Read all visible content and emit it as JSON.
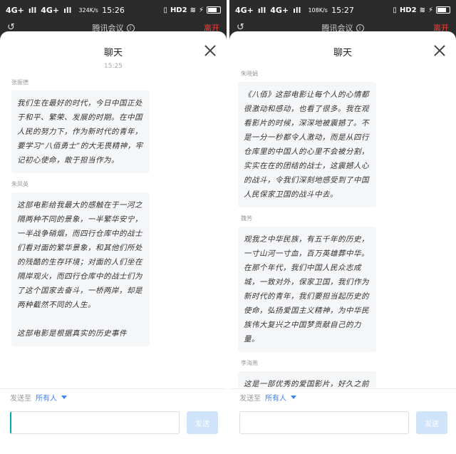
{
  "left": {
    "status": {
      "carrier1": "4G+",
      "carrier2": "4G+",
      "speed": "324K/s",
      "time": "15:26",
      "hd": "HD2"
    },
    "appbar": {
      "title": "腾讯会议",
      "leave": "离开"
    },
    "sheet_title": "聊天",
    "timestamp": "15:25",
    "messages": [
      {
        "sender": "张振德",
        "text": "我们生在最好的时代，今日中国正处于和平、繁荣、发展的时期。在中国人民的努力下，作为新时代的青年，要学习“八佰勇士”的大无畏精神，牢记初心使命，敢于担当作为。"
      },
      {
        "sender": "朱凤英",
        "text": "这部电影给我最大的感触在于一河之隔两种不同的景象，一半繁华安宁，一半战争硝烟，而四行仓库中的战士们看对面的繁华景象，和其他们所处的残酷的生存环境；对面的人们坐在隔岸观火，而四行仓库中的战士们为了这个国家去奋斗，一桥两岸，却是两种截然不同的人生。"
      },
      {
        "sender": "",
        "text": "这部电影是根据真实的历史事件"
      }
    ],
    "footer": {
      "send_to_label": "发送至",
      "send_to_target": "所有人",
      "input_value": "",
      "send_label": "发送"
    }
  },
  "right": {
    "status": {
      "carrier1": "4G+",
      "carrier2": "4G+",
      "speed": "108K/s",
      "time": "15:27",
      "hd": "HD2"
    },
    "appbar": {
      "title": "腾讯会议",
      "leave": "离开"
    },
    "sheet_title": "聊天",
    "messages": [
      {
        "sender": "朱晓娟",
        "text": "《八佰》这部电影让每个人的心情都很激动和感动，也看了很多。我在观看影片的时候，深深地被震撼了。不是一分一秒都令人激动，而是从四行仓库里的中国人的心里不会被分割，实实在在的团结的战士，这震撼人心的战斗，令我们深刻地感受到了中国人民保家卫国的战斗中去。"
      },
      {
        "sender": "魏芳",
        "text": "观我之中华民族，有五千年的历史，一寸山河一寸血，百万英雄葬中华。在那个年代，我们中国人民众志成城，一致对外，保家卫国，我们作为新时代的青年，我们要担当起历史的使命，弘扬爱国主义精神，为中华民族伟大复兴之中国梦贡献自己的力量。"
      },
      {
        "sender": "李海燕",
        "text": "这是一部优秀的爱国影片，好久之前就听说过，可一直没上映。听说是因为政治因素。因为一直是以抗日战争的正面战场的主力部队，在初期时是一直溃败，那些"
      }
    ],
    "footer": {
      "send_to_label": "发送至",
      "send_to_target": "所有人",
      "input_value": "",
      "send_label": "发送"
    }
  }
}
